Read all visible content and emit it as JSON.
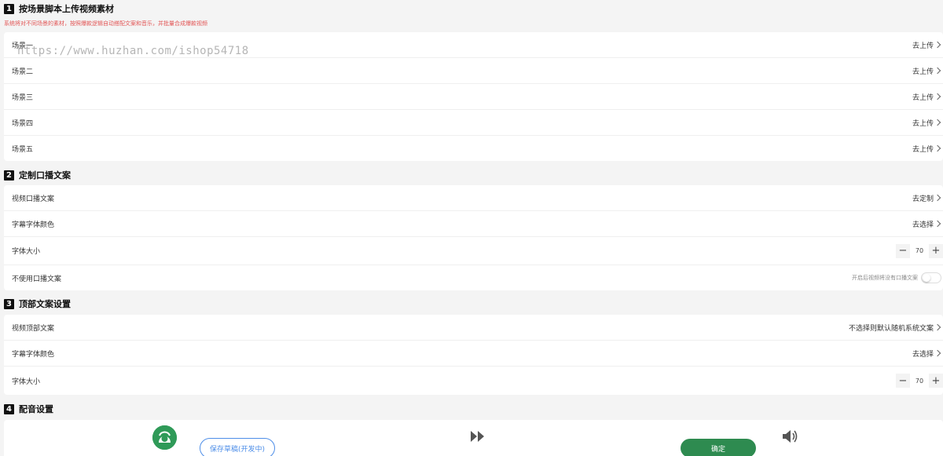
{
  "section1": {
    "number": "1",
    "title": "按场景脚本上传视频素材",
    "note": "系统将对不同场景的素材，按照爆款逻辑自动搭配文案和音乐，并批量合成爆款视频",
    "rows": [
      {
        "label": "场景一",
        "action": "去上传"
      },
      {
        "label": "场景二",
        "action": "去上传"
      },
      {
        "label": "场景三",
        "action": "去上传"
      },
      {
        "label": "场景四",
        "action": "去上传"
      },
      {
        "label": "场景五",
        "action": "去上传"
      }
    ]
  },
  "section2": {
    "number": "2",
    "title": "定制口播文案",
    "script": {
      "label": "视频口播文案",
      "action": "去定制"
    },
    "color": {
      "label": "字幕字体颜色",
      "action": "去选择"
    },
    "size": {
      "label": "字体大小",
      "minus": "−",
      "value": "70",
      "plus": "+"
    },
    "disable": {
      "label": "不使用口播文案",
      "hint": "开启后视频将没有口播文案",
      "enabled": false
    }
  },
  "section3": {
    "number": "3",
    "title": "顶部文案设置",
    "text": {
      "label": "视频顶部文案",
      "action": "不选择则默认随机系统文案"
    },
    "color": {
      "label": "字幕字体颜色",
      "action": "去选择"
    },
    "size": {
      "label": "字体大小",
      "minus": "−",
      "value": "70",
      "plus": "+"
    }
  },
  "section4": {
    "number": "4",
    "title": "配音设置"
  },
  "footer": {
    "draft_button": "保存草稿(开发中)",
    "confirm_button": "确定"
  },
  "watermark": "https://www.huzhan.com/ishop54718",
  "colors": {
    "accent_green": "#2e8b50",
    "draft_blue": "#4e8ee8",
    "note_red": "#e25555"
  },
  "icons": [
    "chevron-right-icon",
    "avatar-icon",
    "fast-forward-icon",
    "volume-icon"
  ]
}
